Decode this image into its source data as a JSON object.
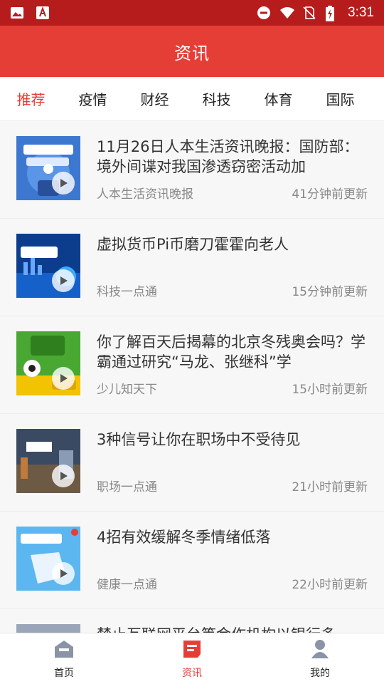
{
  "status_bar": {
    "time": "3:31",
    "left_icons": [
      "image-icon",
      "text-app-icon"
    ],
    "right_icons": [
      "do-not-disturb-icon",
      "wifi-icon",
      "no-sim-icon",
      "battery-charging-icon"
    ]
  },
  "header": {
    "title": "资讯"
  },
  "tabs": [
    {
      "label": "推荐",
      "active": true
    },
    {
      "label": "疫情",
      "active": false
    },
    {
      "label": "财经",
      "active": false
    },
    {
      "label": "科技",
      "active": false
    },
    {
      "label": "体育",
      "active": false
    },
    {
      "label": "国际",
      "active": false
    }
  ],
  "news": [
    {
      "title": "11月26日人本生活资讯晚报：国防部：境外间谍对我国渗透窃密活动加",
      "source": "人本生活资讯晚报",
      "time": "41分钟前更新",
      "thumb_text": "人本生活资讯晚报",
      "thumb_color": "#2e63b8"
    },
    {
      "title": "虚拟货币Pi币磨刀霍霍向老人",
      "source": "科技一点通",
      "time": "15分钟前更新",
      "thumb_text": "科技一点通",
      "thumb_color": "#0b3d8c"
    },
    {
      "title": "你了解百天后揭幕的北京冬残奥会吗？学霸通过研究“马龙、张继科”学",
      "source": "少儿知天下",
      "time": "15小时前更新",
      "thumb_text": "少儿知天下",
      "thumb_color": "#3a8f2a"
    },
    {
      "title": "3种信号让你在职场中不受待见",
      "source": "职场一点通",
      "time": "21小时前更新",
      "thumb_text": "职场一点通",
      "thumb_color": "#2a3b55"
    },
    {
      "title": "4招有效缓解冬季情绪低落",
      "source": "健康一点通",
      "time": "22小时前更新",
      "thumb_text": "健康一点通",
      "thumb_color": "#3d9ee0"
    },
    {
      "title": "禁止互联网平台等金作机构以银行多",
      "source": "",
      "time": "",
      "thumb_text": "",
      "thumb_color": "#9aa6b8"
    }
  ],
  "bottom_nav": [
    {
      "label": "首页",
      "icon": "home-icon",
      "active": false
    },
    {
      "label": "资讯",
      "icon": "news-icon",
      "active": true
    },
    {
      "label": "我的",
      "icon": "profile-icon",
      "active": false
    }
  ],
  "colors": {
    "accent": "#e53e36",
    "status_bar": "#b71c1c"
  }
}
